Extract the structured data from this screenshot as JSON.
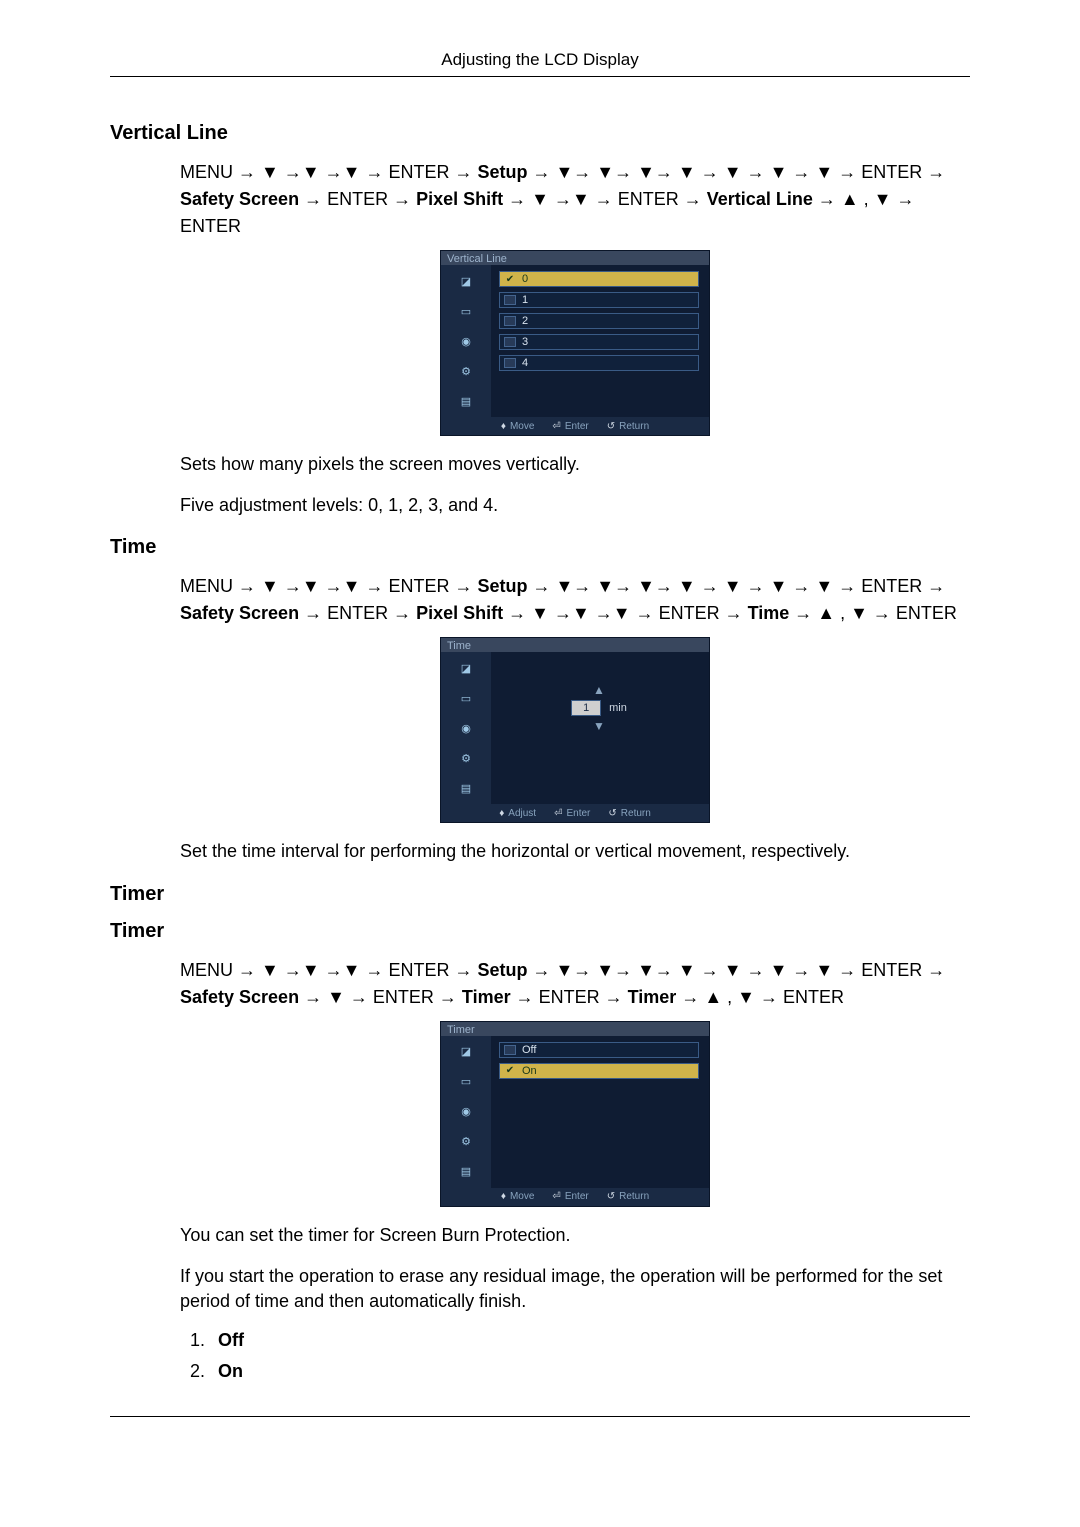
{
  "header": "Adjusting the LCD Display",
  "sections": {
    "vertical_line": {
      "title": "Vertical Line",
      "path_plain_1": "MENU → ▼ →▼ →▼ → ENTER → ",
      "path_bold_1": "Setup",
      "path_plain_2": " → ▼→ ▼→ ▼→ ▼ → ▼ → ▼ → ▼ → ENTER → ",
      "path_bold_2": "Safety Screen",
      "path_plain_3": " → ENTER → ",
      "path_bold_3": "Pixel Shift",
      "path_plain_4": " → ▼ →▼ → ENTER → ",
      "path_bold_4": "Vertical Line",
      "path_plain_5": " → ▲ , ▼ → ENTER",
      "osd_title": "Vertical Line",
      "options": [
        "0",
        "1",
        "2",
        "3",
        "4"
      ],
      "selected_index": 0,
      "foot": {
        "move": "Move",
        "enter": "Enter",
        "return": "Return"
      },
      "desc1": "Sets how many pixels the screen moves vertically.",
      "desc2": "Five adjustment levels: 0, 1, 2, 3, and 4."
    },
    "time": {
      "title": "Time",
      "path_plain_1": "MENU → ▼ →▼ →▼ → ENTER → ",
      "path_bold_1": "Setup",
      "path_plain_2": " → ▼→ ▼→ ▼→ ▼ → ▼ → ▼ → ▼ → ENTER → ",
      "path_bold_2": "Safety Screen",
      "path_plain_3": " → ENTER → ",
      "path_bold_3": "Pixel Shift",
      "path_plain_4": " → ▼ →▼ →▼ → ENTER → ",
      "path_bold_4": "Time",
      "path_plain_5": " → ▲ , ▼ → ENTER",
      "osd_title": "Time",
      "value": "1",
      "unit": "min",
      "foot": {
        "adjust": "Adjust",
        "enter": "Enter",
        "return": "Return"
      },
      "desc1": "Set the time interval for performing the horizontal or vertical movement, respectively."
    },
    "timer": {
      "title1": "Timer",
      "title2": "Timer",
      "path_plain_1": "MENU → ▼ →▼ →▼ → ENTER → ",
      "path_bold_1": "Setup",
      "path_plain_2": " → ▼→ ▼→ ▼→ ▼ → ▼ → ▼ → ▼ → ENTER → ",
      "path_bold_2": "Safety Screen",
      "path_plain_3": " → ▼ → ENTER → ",
      "path_bold_3": "Timer",
      "path_plain_4": " → ENTER → ",
      "path_bold_4": "Timer",
      "path_plain_5": " → ▲ , ▼ → ENTER",
      "osd_title": "Timer",
      "options": [
        "Off",
        "On"
      ],
      "selected_index": 1,
      "foot": {
        "move": "Move",
        "enter": "Enter",
        "return": "Return"
      },
      "desc1": "You can set the timer for Screen Burn Protection.",
      "desc2": "If you start the operation to erase any residual image, the operation will be performed for the set period of time and then automatically finish.",
      "list": [
        "Off",
        "On"
      ]
    }
  },
  "icons": {
    "picture": "◪",
    "input": "▭",
    "power": "◉",
    "gear": "⚙",
    "multi": "▤"
  },
  "foot_glyph": {
    "move": "♦",
    "enter": "⏎",
    "return": "↺"
  }
}
